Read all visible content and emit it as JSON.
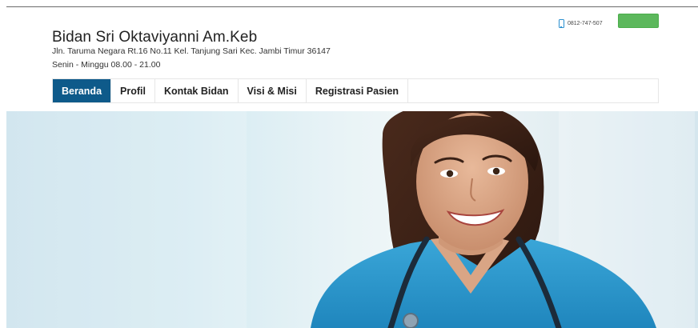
{
  "header": {
    "title": "Bidan Sri Oktaviyanni Am.Keb",
    "address": "Jln. Taruma Negara Rt.16 No.11 Kel. Tanjung Sari Kec. Jambi Timur 36147",
    "hours": "Senin - Minggu 08.00 - 21.00",
    "phone": "0812-747-507",
    "phone_icon": "mobile-phone-icon",
    "button_color": "#5cb85c"
  },
  "nav": {
    "active_color": "#0e5a8a",
    "items": [
      {
        "label": "Beranda",
        "active": true
      },
      {
        "label": "Profil",
        "active": false
      },
      {
        "label": "Kontak Bidan",
        "active": false
      },
      {
        "label": "Visi & Misi",
        "active": false
      },
      {
        "label": "Registrasi Pasien",
        "active": false
      }
    ]
  },
  "hero": {
    "image": "smiling nurse with stethoscope"
  }
}
